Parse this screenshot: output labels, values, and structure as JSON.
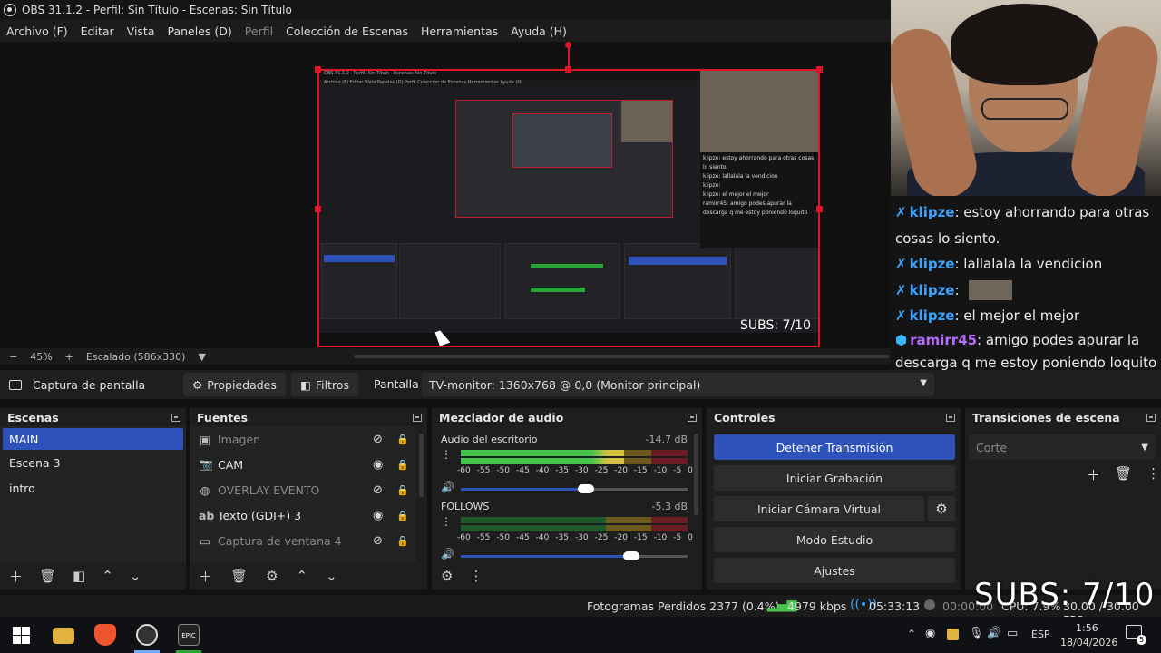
{
  "window": {
    "title": "OBS 31.1.2 - Perfil: Sin Título - Escenas: Sin Título"
  },
  "menu": [
    "Archivo (F)",
    "Editar",
    "Vista",
    "Paneles (D)",
    "Perfil",
    "Colección de Escenas",
    "Herramientas",
    "Ayuda (H)"
  ],
  "preview": {
    "zoom": "45%",
    "zoom_plus": "+",
    "scale_mode": "Escalado (586x330)",
    "inner_subs": "SUBS: 7/10",
    "inner_title": "OBS 31.1.2 - Perfil: Sin Título - Escenas: Sin Título",
    "inner_menu": "Archivo (F)   Editar   Vista   Paneles (D)   Perfil   Colección de Escenas   Herramientas   Ayuda (H)",
    "inner_chat": [
      "klipze: estoy ahorrando para otras cosas lo siento.",
      "klipze: lallalala la vendicion",
      "klipze:",
      "klipze: el mejor el mejor",
      "ramirr45: amigo podes apurar la descarga q me estoy poniendo loquito"
    ]
  },
  "chat": [
    {
      "name": "klipze",
      "text": ": estoy ahorrando para otras cosas lo siento.",
      "color": "#3aa3ff",
      "icon": "✗"
    },
    {
      "name": "klipze",
      "text": ": lallalala la vendicion",
      "color": "#3aa3ff",
      "icon": "✗"
    },
    {
      "name": "klipze",
      "text": ":",
      "color": "#3aa3ff",
      "icon": "✗"
    },
    {
      "name": "klipze",
      "text": ": el mejor el mejor",
      "color": "#3aa3ff",
      "icon": "✗"
    },
    {
      "name": "ramirr45",
      "text": ": amigo podes apurar la descarga q me estoy poniendo loquito",
      "color": "#b66bff",
      "icon": "⬢"
    }
  ],
  "source_bar": {
    "source_name": "Captura de pantalla",
    "properties": "Propiedades",
    "filters": "Filtros",
    "display_label": "Pantalla",
    "display_value": "TV-monitor: 1360x768 @ 0,0 (Monitor principal)"
  },
  "scenes": {
    "title": "Escenas",
    "items": [
      "MAIN",
      "Escena 3",
      "intro"
    ],
    "selected": "MAIN"
  },
  "sources": {
    "title": "Fuentes",
    "items": [
      {
        "label": "Imagen",
        "icon": "image-icon",
        "visible": false
      },
      {
        "label": "CAM",
        "icon": "camera-icon",
        "visible": true
      },
      {
        "label": "OVERLAY EVENTO",
        "icon": "browser-icon",
        "visible": false
      },
      {
        "label": "Texto (GDI+) 3",
        "icon": "text-icon",
        "visible": true
      },
      {
        "label": "Captura de ventana 4",
        "icon": "window-icon",
        "visible": false
      }
    ]
  },
  "mixer": {
    "title": "Mezclador de audio",
    "ticks": [
      "-60",
      "-55",
      "-50",
      "-45",
      "-40",
      "-35",
      "-30",
      "-25",
      "-20",
      "-15",
      "-10",
      "-5",
      "0"
    ],
    "channels": [
      {
        "name": "Audio del escritorio",
        "db": "-14.7 dB",
        "level": 0.72,
        "volume": 0.55
      },
      {
        "name": "FOLLOWS",
        "db": "-5.3 dB",
        "level": 0.0,
        "volume": 0.75
      }
    ]
  },
  "controls": {
    "title": "Controles",
    "stop_stream": "Detener Transmisión",
    "start_record": "Iniciar Grabación",
    "start_virtualcam": "Iniciar Cámara Virtual",
    "studio_mode": "Modo Estudio",
    "settings": "Ajustes"
  },
  "transitions": {
    "title": "Transiciones de escena",
    "selected": "Corte"
  },
  "status": {
    "dropped_frames": "Fotogramas Perdidos 2377 (0.4%)",
    "bitrate": "4979 kbps",
    "stream_time": "05:33:13",
    "record_time": "00:00:00",
    "cpu": "CPU: 7.9%",
    "fps": "30.00 / 30.00 FPS"
  },
  "subs_overlay": "SUBS: 7/10",
  "taskbar": {
    "time": "1:56",
    "date": "18/04/2026",
    "language": "ESP",
    "notifications": "5"
  },
  "colors": {
    "accent": "#2d52b9",
    "preview_border": "#e0152a",
    "meter_green": "#46c64d",
    "meter_yellow": "#d6c046",
    "meter_red": "#6a1d22"
  }
}
